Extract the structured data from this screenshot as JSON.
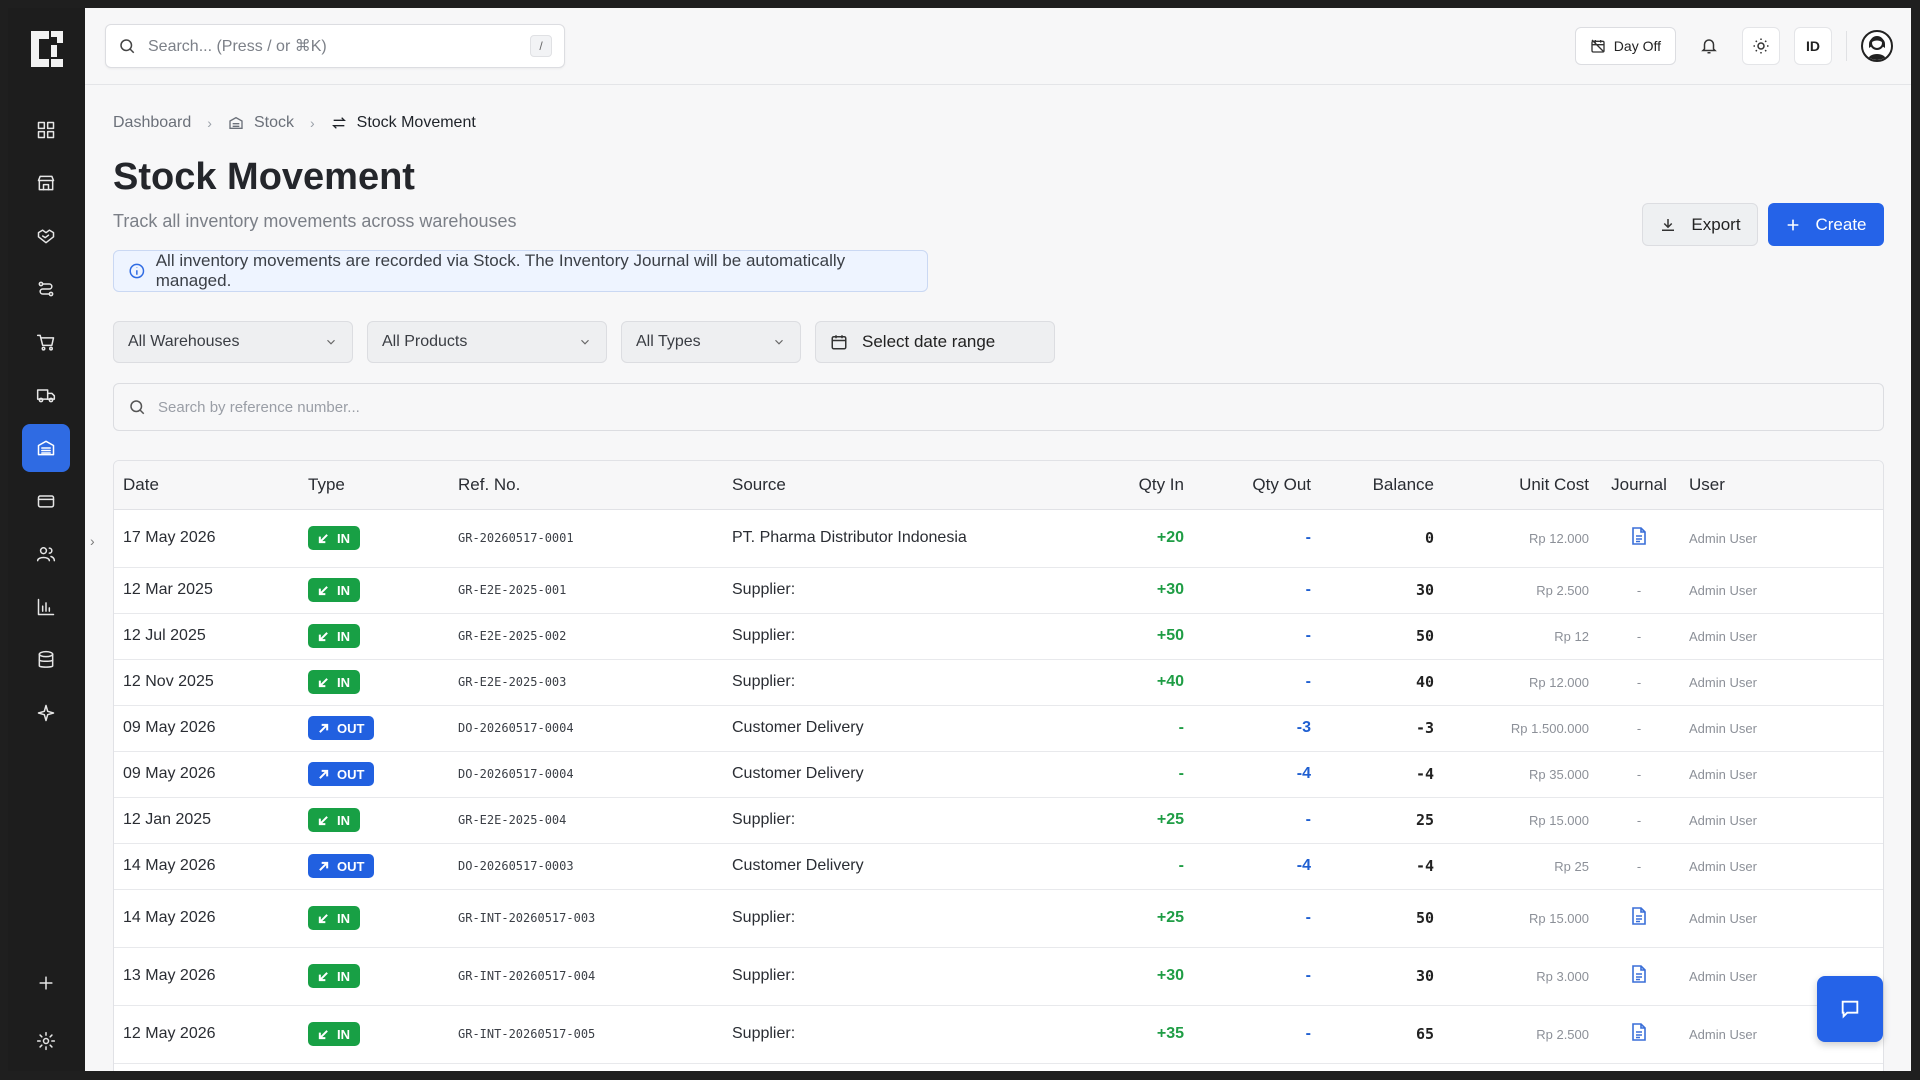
{
  "colors": {
    "accent": "#2563e8",
    "in_badge": "#18a045",
    "out_badge": "#2160e0"
  },
  "sidebar": {
    "items": [
      {
        "icon": "dashboard-icon",
        "active": false
      },
      {
        "icon": "store-icon",
        "active": false
      },
      {
        "icon": "handshake-icon",
        "active": false
      },
      {
        "icon": "flow-icon",
        "active": false
      },
      {
        "icon": "cart-icon",
        "active": false
      },
      {
        "icon": "truck-icon",
        "active": false
      },
      {
        "icon": "warehouse-icon",
        "active": true
      },
      {
        "icon": "card-icon",
        "active": false
      },
      {
        "icon": "users-icon",
        "active": false
      },
      {
        "icon": "chart-icon",
        "active": false
      },
      {
        "icon": "database-icon",
        "active": false
      },
      {
        "icon": "sparkle-icon",
        "active": false
      }
    ]
  },
  "topbar": {
    "search_placeholder": "Search... (Press / or ⌘K)",
    "search_shortcut": "/",
    "dayoff_label": "Day Off",
    "language": "ID"
  },
  "breadcrumb": {
    "home": "Dashboard",
    "parent": "Stock",
    "current": "Stock Movement"
  },
  "page": {
    "title": "Stock Movement",
    "subtitle": "Track all inventory movements across warehouses",
    "export_label": "Export",
    "create_label": "Create",
    "info_text": "All inventory movements are recorded via Stock. The Inventory Journal will be automatically managed."
  },
  "filters": {
    "warehouse": "All Warehouses",
    "product": "All Products",
    "type": "All Types",
    "date": "Select date range",
    "search_placeholder": "Search by reference number..."
  },
  "table": {
    "headers": [
      "Date",
      "Type",
      "Ref. No.",
      "Source",
      "Qty In",
      "Qty Out",
      "Balance",
      "Unit Cost",
      "Journal",
      "User"
    ],
    "rows": [
      {
        "date": "17 May 2026",
        "type": "IN",
        "ref": "GR-20260517-0001",
        "source": "PT. Pharma Distributor Indonesia",
        "qty_in": "+20",
        "qty_out": "-",
        "balance": "0",
        "unit_cost": "Rp 12.000",
        "journal": "doc",
        "user": "Admin User"
      },
      {
        "date": "12 Mar 2025",
        "type": "IN",
        "ref": "GR-E2E-2025-001",
        "source": "Supplier:",
        "qty_in": "+30",
        "qty_out": "-",
        "balance": "30",
        "unit_cost": "Rp 2.500",
        "journal": "-",
        "user": "Admin User"
      },
      {
        "date": "12 Jul 2025",
        "type": "IN",
        "ref": "GR-E2E-2025-002",
        "source": "Supplier:",
        "qty_in": "+50",
        "qty_out": "-",
        "balance": "50",
        "unit_cost": "Rp 12",
        "journal": "-",
        "user": "Admin User"
      },
      {
        "date": "12 Nov 2025",
        "type": "IN",
        "ref": "GR-E2E-2025-003",
        "source": "Supplier:",
        "qty_in": "+40",
        "qty_out": "-",
        "balance": "40",
        "unit_cost": "Rp 12.000",
        "journal": "-",
        "user": "Admin User"
      },
      {
        "date": "09 May 2026",
        "type": "OUT",
        "ref": "DO-20260517-0004",
        "source": "Customer Delivery",
        "qty_in": "-",
        "qty_out": "-3",
        "balance": "-3",
        "unit_cost": "Rp 1.500.000",
        "journal": "-",
        "user": "Admin User"
      },
      {
        "date": "09 May 2026",
        "type": "OUT",
        "ref": "DO-20260517-0004",
        "source": "Customer Delivery",
        "qty_in": "-",
        "qty_out": "-4",
        "balance": "-4",
        "unit_cost": "Rp 35.000",
        "journal": "-",
        "user": "Admin User"
      },
      {
        "date": "12 Jan 2025",
        "type": "IN",
        "ref": "GR-E2E-2025-004",
        "source": "Supplier:",
        "qty_in": "+25",
        "qty_out": "-",
        "balance": "25",
        "unit_cost": "Rp 15.000",
        "journal": "-",
        "user": "Admin User"
      },
      {
        "date": "14 May 2026",
        "type": "OUT",
        "ref": "DO-20260517-0003",
        "source": "Customer Delivery",
        "qty_in": "-",
        "qty_out": "-4",
        "balance": "-4",
        "unit_cost": "Rp 25",
        "journal": "-",
        "user": "Admin User"
      },
      {
        "date": "14 May 2026",
        "type": "IN",
        "ref": "GR-INT-20260517-003",
        "source": "Supplier:",
        "qty_in": "+25",
        "qty_out": "-",
        "balance": "50",
        "unit_cost": "Rp 15.000",
        "journal": "doc",
        "user": "Admin User"
      },
      {
        "date": "13 May 2026",
        "type": "IN",
        "ref": "GR-INT-20260517-004",
        "source": "Supplier:",
        "qty_in": "+30",
        "qty_out": "-",
        "balance": "30",
        "unit_cost": "Rp 3.000",
        "journal": "doc",
        "user": "Admin User"
      },
      {
        "date": "12 May 2026",
        "type": "IN",
        "ref": "GR-INT-20260517-005",
        "source": "Supplier:",
        "qty_in": "+35",
        "qty_out": "-",
        "balance": "65",
        "unit_cost": "Rp 2.500",
        "journal": "doc",
        "user": "Admin User"
      }
    ]
  }
}
